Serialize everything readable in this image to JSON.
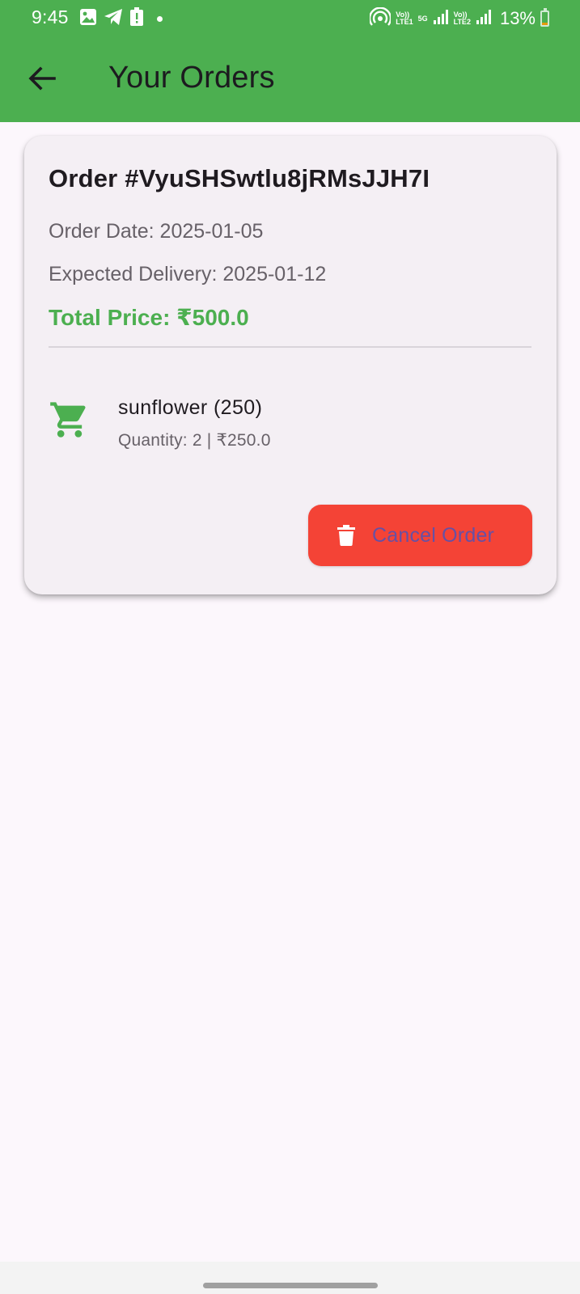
{
  "status_bar": {
    "time": "9:45",
    "network_labels": [
      "Vo)) LTE1",
      "5G",
      "Vo)) LTE2"
    ],
    "battery_percent": "13%",
    "battery_level": 0.13,
    "icons": [
      "gallery-icon",
      "telegram-icon",
      "alert-icon",
      "notification-dot-icon",
      "hotspot-icon",
      "signal-icon",
      "signal-icon",
      "battery-icon"
    ]
  },
  "app_bar": {
    "title": "Your Orders",
    "back_icon": "arrow-left-icon"
  },
  "order": {
    "title": "Order #VyuSHSwtlu8jRMsJJH7I",
    "order_date": "Order Date: 2025-01-05",
    "expected_delivery": "Expected Delivery: 2025-01-12",
    "total_price": "Total Price: ₹500.0",
    "items": [
      {
        "icon": "shopping-cart-icon",
        "name": "sunflower (250)",
        "detail": "Quantity: 2 | ₹250.0"
      }
    ],
    "cancel_button": {
      "icon": "trash-icon",
      "label": "Cancel Order"
    }
  },
  "colors": {
    "app_bar": "#4caf50",
    "price": "#4caf50",
    "cancel_button": "#f44336",
    "cancel_label": "#6750a4",
    "background": "#fcf7fc",
    "card": "#f4eff4"
  }
}
